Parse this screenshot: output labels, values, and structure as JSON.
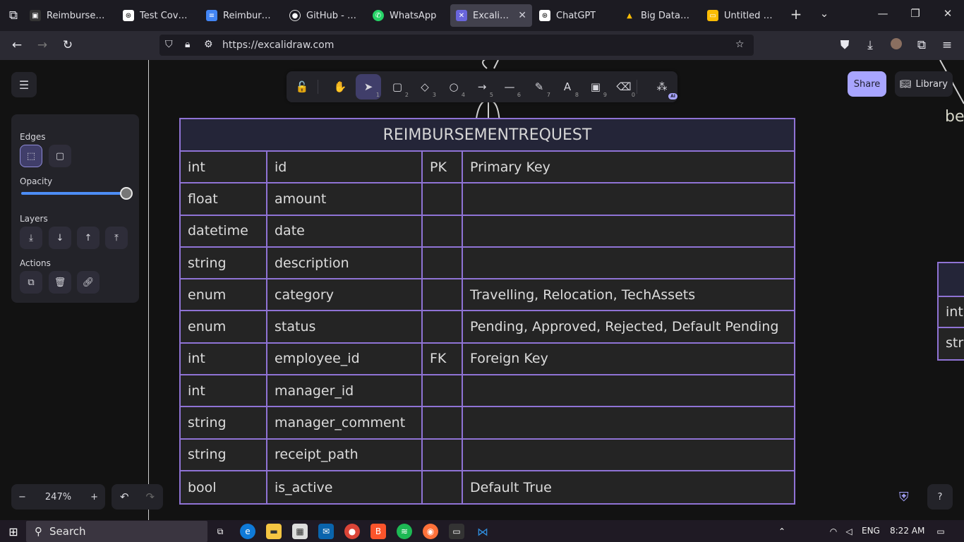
{
  "browser": {
    "tabs": [
      {
        "label": "Reimbursement P",
        "icon": "folder-icon",
        "active": false
      },
      {
        "label": "Test Coverage",
        "icon": "chatgpt-icon",
        "active": false
      },
      {
        "label": "Reimburseme",
        "icon": "docs-icon",
        "active": false
      },
      {
        "label": "GitHub - gh-g",
        "icon": "github-icon",
        "active": false
      },
      {
        "label": "WhatsApp",
        "icon": "whatsapp-icon",
        "active": false
      },
      {
        "label": "Excalidraw",
        "icon": "excalidraw-icon",
        "active": true
      },
      {
        "label": "ChatGPT",
        "icon": "chatgpt-icon",
        "active": false
      },
      {
        "label": "Big Data - Goo",
        "icon": "drive-icon",
        "active": false
      },
      {
        "label": "Untitled prese",
        "icon": "slides-icon",
        "active": false
      }
    ],
    "url": "https://excalidraw.com"
  },
  "toolbar": {
    "tools": [
      {
        "name": "lock",
        "glyph": "🔓",
        "num": ""
      },
      {
        "name": "hand",
        "glyph": "✋",
        "num": ""
      },
      {
        "name": "selection",
        "glyph": "➤",
        "num": "1"
      },
      {
        "name": "rectangle",
        "glyph": "▢",
        "num": "2"
      },
      {
        "name": "diamond",
        "glyph": "◇",
        "num": "3"
      },
      {
        "name": "ellipse",
        "glyph": "○",
        "num": "4"
      },
      {
        "name": "arrow",
        "glyph": "→",
        "num": "5"
      },
      {
        "name": "line",
        "glyph": "—",
        "num": "6"
      },
      {
        "name": "pencil",
        "glyph": "✎",
        "num": "7"
      },
      {
        "name": "text",
        "glyph": "A",
        "num": "8"
      },
      {
        "name": "image",
        "glyph": "▣",
        "num": "9"
      },
      {
        "name": "eraser",
        "glyph": "⌫",
        "num": "0"
      },
      {
        "name": "more-tools",
        "glyph": "⁂",
        "num": ""
      }
    ],
    "ai_badge": "AI"
  },
  "share_label": "Share",
  "library_label": "Library",
  "properties": {
    "edges_label": "Edges",
    "opacity_label": "Opacity",
    "opacity_value": 100,
    "layers_label": "Layers",
    "actions_label": "Actions"
  },
  "table": {
    "title": "REIMBURSEMENTREQUEST",
    "rows": [
      [
        "int",
        "id",
        "PK",
        "Primary Key"
      ],
      [
        "float",
        "amount",
        "",
        ""
      ],
      [
        "datetime",
        "date",
        "",
        ""
      ],
      [
        "string",
        "description",
        "",
        ""
      ],
      [
        "enum",
        "category",
        "",
        "Travelling, Relocation, TechAssets"
      ],
      [
        "enum",
        "status",
        "",
        "Pending, Approved, Rejected, Default Pending"
      ],
      [
        "int",
        "employee_id",
        "FK",
        "Foreign Key"
      ],
      [
        "int",
        "manager_id",
        "",
        ""
      ],
      [
        "string",
        "manager_comment",
        "",
        ""
      ],
      [
        "string",
        "receipt_path",
        "",
        ""
      ],
      [
        "bool",
        "is_active",
        "",
        "Default True"
      ]
    ]
  },
  "right_table_rows": [
    "int",
    "str"
  ],
  "right_text": "be",
  "zoom_value": "247%",
  "taskbar": {
    "search_label": "Search",
    "language": "ENG",
    "time": "8:22 AM"
  }
}
